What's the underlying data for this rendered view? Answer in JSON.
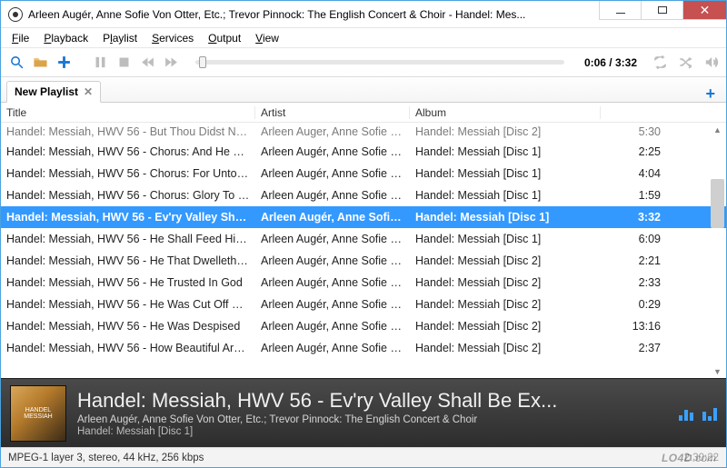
{
  "window": {
    "title": "Arleen Augér, Anne Sofie Von Otter, Etc.; Trevor Pinnock: The English Concert & Choir - Handel: Mes..."
  },
  "menu": {
    "file": "File",
    "playback": "Playback",
    "playlist": "Playlist",
    "services": "Services",
    "output": "Output",
    "view": "View"
  },
  "toolbar": {
    "time": "0:06 / 3:32"
  },
  "tab": {
    "name": "New Playlist"
  },
  "columns": {
    "title": "Title",
    "artist": "Artist",
    "album": "Album"
  },
  "tracks": [
    {
      "title": "Handel: Messiah, HWV 56 - But Thou Didst Not L...",
      "artist": "Arleen Auger, Anne Sofie Von...",
      "album": "Handel: Messiah [Disc 2]",
      "time": "5:30",
      "partial": true
    },
    {
      "title": "Handel: Messiah, HWV 56 - Chorus: And He Shall...",
      "artist": "Arleen Augér, Anne Sofie Von...",
      "album": "Handel: Messiah [Disc 1]",
      "time": "2:25"
    },
    {
      "title": "Handel: Messiah, HWV 56 - Chorus: For Unto Us ...",
      "artist": "Arleen Augér, Anne Sofie Von...",
      "album": "Handel: Messiah [Disc 1]",
      "time": "4:04"
    },
    {
      "title": "Handel: Messiah, HWV 56 - Chorus: Glory To Go...",
      "artist": "Arleen Augér, Anne Sofie Von...",
      "album": "Handel: Messiah [Disc 1]",
      "time": "1:59"
    },
    {
      "title": "Handel: Messiah, HWV 56 - Ev'ry Valley Shall B...",
      "artist": "Arleen Augér, Anne Sofie V...",
      "album": "Handel: Messiah [Disc 1]",
      "time": "3:32",
      "selected": true
    },
    {
      "title": "Handel: Messiah, HWV 56 - He Shall Feed His Flo...",
      "artist": "Arleen Augér, Anne Sofie Von...",
      "album": "Handel: Messiah [Disc 1]",
      "time": "6:09"
    },
    {
      "title": "Handel: Messiah, HWV 56 - He That Dwelleth In ...",
      "artist": "Arleen Augér, Anne Sofie Von...",
      "album": "Handel: Messiah [Disc 2]",
      "time": "2:21"
    },
    {
      "title": "Handel: Messiah, HWV 56 - He Trusted In God",
      "artist": "Arleen Augér, Anne Sofie Von...",
      "album": "Handel: Messiah [Disc 2]",
      "time": "2:33"
    },
    {
      "title": "Handel: Messiah, HWV 56 - He Was Cut Off Out ...",
      "artist": "Arleen Augér, Anne Sofie Von...",
      "album": "Handel: Messiah [Disc 2]",
      "time": "0:29"
    },
    {
      "title": "Handel: Messiah, HWV 56 - He Was Despised",
      "artist": "Arleen Augér, Anne Sofie Von...",
      "album": "Handel: Messiah [Disc 2]",
      "time": "13:16"
    },
    {
      "title": "Handel: Messiah, HWV 56 - How Beautiful Are T...",
      "artist": "Arleen Augér, Anne Sofie Von...",
      "album": "Handel: Messiah [Disc 2]",
      "time": "2:37"
    }
  ],
  "nowplaying": {
    "title": "Handel: Messiah, HWV 56 - Ev'ry Valley Shall Be Ex...",
    "artist": "Arleen Augér, Anne Sofie Von Otter, Etc.; Trevor Pinnock: The English Concert & Choir",
    "album": "Handel: Messiah [Disc 1]",
    "art_text": "HANDEL MESSIAH"
  },
  "status": {
    "codec": "MPEG-1 layer 3, stereo, 44 kHz, 256 kbps",
    "watermark_brand": "LO4D",
    "watermark_suffix": ".com",
    "total": "2:30:22"
  }
}
